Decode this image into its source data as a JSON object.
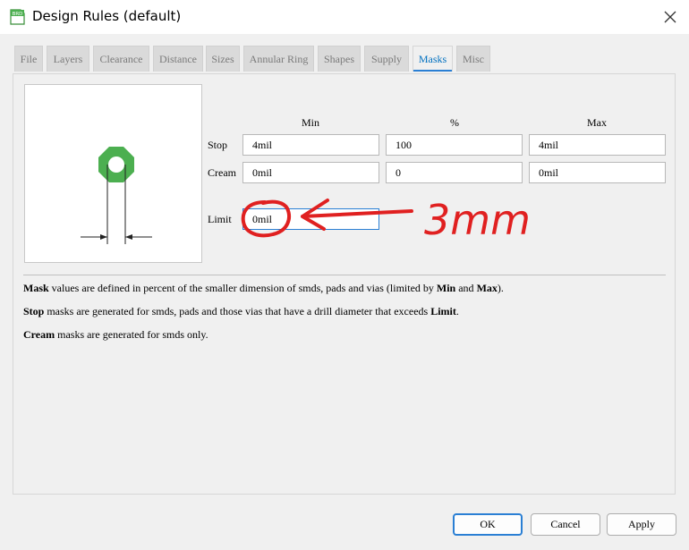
{
  "window": {
    "title": "Design Rules (default)",
    "icon_text": "BRD"
  },
  "tabs": [
    {
      "label": "File",
      "active": false
    },
    {
      "label": "Layers",
      "active": false
    },
    {
      "label": "Clearance",
      "active": false
    },
    {
      "label": "Distance",
      "active": false
    },
    {
      "label": "Sizes",
      "active": false
    },
    {
      "label": "Annular Ring",
      "active": false
    },
    {
      "label": "Shapes",
      "active": false
    },
    {
      "label": "Supply",
      "active": false
    },
    {
      "label": "Masks",
      "active": true
    },
    {
      "label": "Misc",
      "active": false
    }
  ],
  "masks": {
    "columns": {
      "min": "Min",
      "percent": "%",
      "max": "Max"
    },
    "stop": {
      "label": "Stop",
      "min": "4mil",
      "percent": "100",
      "max": "4mil"
    },
    "cream": {
      "label": "Cream",
      "min": "0mil",
      "percent": "0",
      "max": "0mil"
    },
    "limit": {
      "label": "Limit",
      "value": "0mil"
    }
  },
  "description": {
    "line1": {
      "b1": "Mask",
      "t1": " values are defined in percent of the smaller dimension of smds, pads and vias (limited by ",
      "b2": "Min",
      "t2": " and ",
      "b3": "Max",
      "t3": ")."
    },
    "line2": {
      "b1": "Stop",
      "t1": " masks are generated for smds, pads and those vias that have a drill diameter that exceeds ",
      "b2": "Limit",
      "t2": "."
    },
    "line3": {
      "b1": "Cream",
      "t1": " masks are generated for smds only."
    }
  },
  "annotation": {
    "text": "3mm",
    "color": "#e02020"
  },
  "buttons": {
    "ok": "OK",
    "cancel": "Cancel",
    "apply": "Apply"
  },
  "colors": {
    "pad": "#4caf50",
    "accent": "#2a7fd4",
    "active_tab_text": "#0070c0"
  }
}
